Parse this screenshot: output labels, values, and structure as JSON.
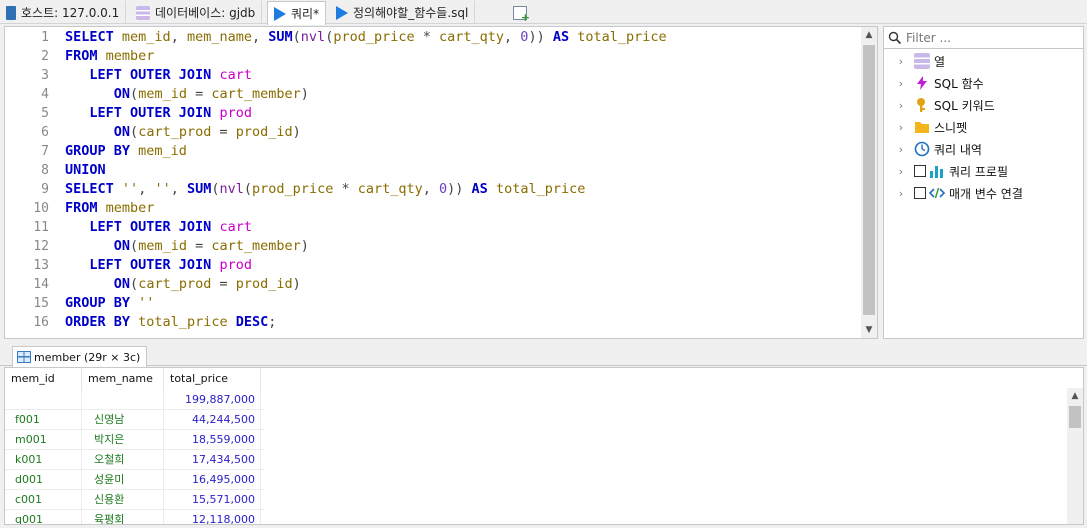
{
  "tabs": [
    {
      "label": "호스트: 127.0.0.1",
      "icon": "host-icon"
    },
    {
      "label": "데이터베이스: gjdb",
      "icon": "database-icon"
    },
    {
      "label": "쿼리*",
      "icon": "play-icon"
    },
    {
      "label": "정의해야할_함수들.sql",
      "icon": "play-icon"
    }
  ],
  "editor": {
    "line_numbers": [
      "1",
      "2",
      "3",
      "4",
      "5",
      "6",
      "7",
      "8",
      "9",
      "10",
      "11",
      "12",
      "13",
      "14",
      "15",
      "16"
    ]
  },
  "sidepanel": {
    "filter_placeholder": "Filter ...",
    "items": [
      {
        "label": "열",
        "icon": "columns-icon"
      },
      {
        "label": "SQL 함수",
        "icon": "lightning-icon"
      },
      {
        "label": "SQL 키워드",
        "icon": "key-icon"
      },
      {
        "label": "스니펫",
        "icon": "folder-icon"
      },
      {
        "label": "쿼리 내역",
        "icon": "clock-icon"
      },
      {
        "label": "쿼리 프로필",
        "icon": "bar-chart-icon"
      },
      {
        "label": "매개 변수 연결",
        "icon": "code-icon"
      }
    ]
  },
  "results": {
    "tab_label": "member (29r × 3c)",
    "columns": [
      "mem_id",
      "mem_name",
      "total_price"
    ],
    "rows": [
      [
        "",
        "",
        "199,887,000"
      ],
      [
        "f001",
        "신영남",
        "44,244,500"
      ],
      [
        "m001",
        "박지은",
        "18,559,000"
      ],
      [
        "k001",
        "오철희",
        "17,434,500"
      ],
      [
        "d001",
        "성윤미",
        "16,495,000"
      ],
      [
        "c001",
        "신용환",
        "15,571,000"
      ],
      [
        "q001",
        "육평회",
        "12,118,000"
      ]
    ]
  }
}
